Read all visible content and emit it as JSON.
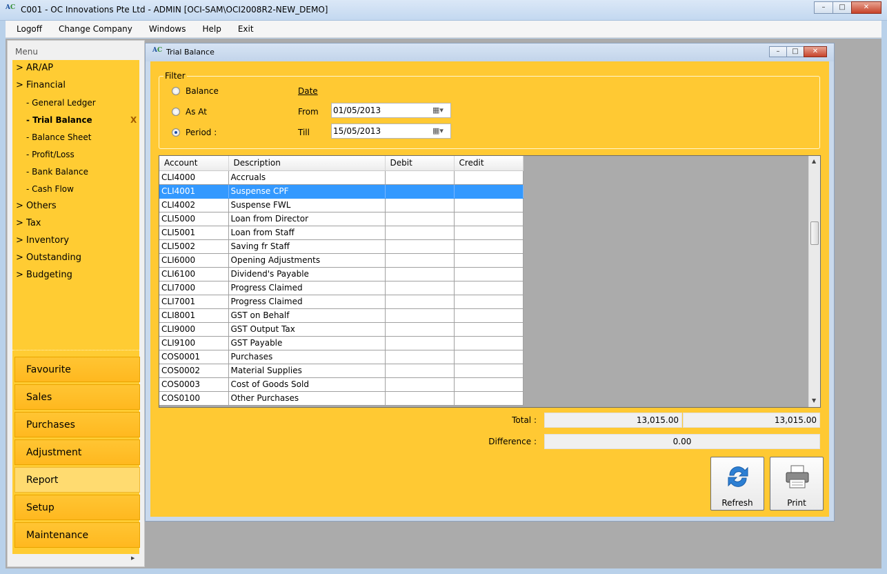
{
  "window": {
    "title": "C001 - OC Innovations Pte Ltd - ADMIN [OCI-SAM\\OCI2008R2-NEW_DEMO]",
    "icon_name": "ac-app-icon"
  },
  "menubar": [
    "Logoff",
    "Change Company",
    "Windows",
    "Help",
    "Exit"
  ],
  "sidebar": {
    "header": "Menu",
    "tree": [
      {
        "label": "> AR/AP"
      },
      {
        "label": "> Financial"
      },
      {
        "label": "- General Ledger",
        "sub": true
      },
      {
        "label": "- Trial Balance",
        "sub": true,
        "active": true,
        "close": "X"
      },
      {
        "label": "- Balance Sheet",
        "sub": true
      },
      {
        "label": "- Profit/Loss",
        "sub": true
      },
      {
        "label": "- Bank Balance",
        "sub": true
      },
      {
        "label": "- Cash Flow",
        "sub": true
      },
      {
        "label": "> Others"
      },
      {
        "label": "> Tax"
      },
      {
        "label": "> Inventory"
      },
      {
        "label": "> Outstanding"
      },
      {
        "label": "> Budgeting"
      }
    ],
    "modules": [
      "Favourite",
      "Sales",
      "Purchases",
      "Adjustment",
      "Report",
      "Setup",
      "Maintenance"
    ],
    "selected_module": "Report"
  },
  "child_window": {
    "title": "Trial Balance",
    "filter": {
      "legend": "Filter",
      "options": [
        {
          "label": "Balance",
          "checked": false
        },
        {
          "label": "As At",
          "checked": false
        },
        {
          "label": "Period :",
          "checked": true
        }
      ],
      "date_header": "Date",
      "from_label": "From",
      "from_value": "01/05/2013",
      "till_label": "Till",
      "till_value": "15/05/2013"
    },
    "grid": {
      "columns": [
        "Account",
        "Description",
        "Debit",
        "Credit"
      ],
      "rows": [
        {
          "account": "CLI4000",
          "description": "Accruals",
          "debit": "",
          "credit": ""
        },
        {
          "account": "CLI4001",
          "description": "Suspense CPF",
          "debit": "",
          "credit": "",
          "selected": true
        },
        {
          "account": "CLI4002",
          "description": "Suspense FWL",
          "debit": "",
          "credit": ""
        },
        {
          "account": "CLI5000",
          "description": "Loan from Director",
          "debit": "",
          "credit": ""
        },
        {
          "account": "CLI5001",
          "description": "Loan from Staff",
          "debit": "",
          "credit": ""
        },
        {
          "account": "CLI5002",
          "description": "Saving fr Staff",
          "debit": "",
          "credit": ""
        },
        {
          "account": "CLI6000",
          "description": "Opening Adjustments",
          "debit": "",
          "credit": ""
        },
        {
          "account": "CLI6100",
          "description": "Dividend's Payable",
          "debit": "",
          "credit": ""
        },
        {
          "account": "CLI7000",
          "description": "Progress Claimed",
          "debit": "",
          "credit": ""
        },
        {
          "account": "CLI7001",
          "description": "Progress Claimed",
          "debit": "",
          "credit": ""
        },
        {
          "account": "CLI8001",
          "description": "GST on Behalf",
          "debit": "",
          "credit": ""
        },
        {
          "account": "CLI9000",
          "description": "GST Output Tax",
          "debit": "",
          "credit": ""
        },
        {
          "account": "CLI9100",
          "description": "GST Payable",
          "debit": "",
          "credit": ""
        },
        {
          "account": "COS0001",
          "description": "Purchases",
          "debit": "",
          "credit": ""
        },
        {
          "account": "COS0002",
          "description": "Material Supplies",
          "debit": "",
          "credit": ""
        },
        {
          "account": "COS0003",
          "description": "Cost of Goods Sold",
          "debit": "",
          "credit": ""
        },
        {
          "account": "COS0100",
          "description": "Other Purchases",
          "debit": "",
          "credit": ""
        }
      ]
    },
    "totals": {
      "total_label": "Total :",
      "total_debit": "13,015.00",
      "total_credit": "13,015.00",
      "difference_label": "Difference :",
      "difference": "0.00"
    },
    "buttons": {
      "refresh": "Refresh",
      "print": "Print"
    }
  },
  "colors": {
    "panel": "#ffc933",
    "selection": "#3399ff",
    "workspace": "#ababab"
  }
}
